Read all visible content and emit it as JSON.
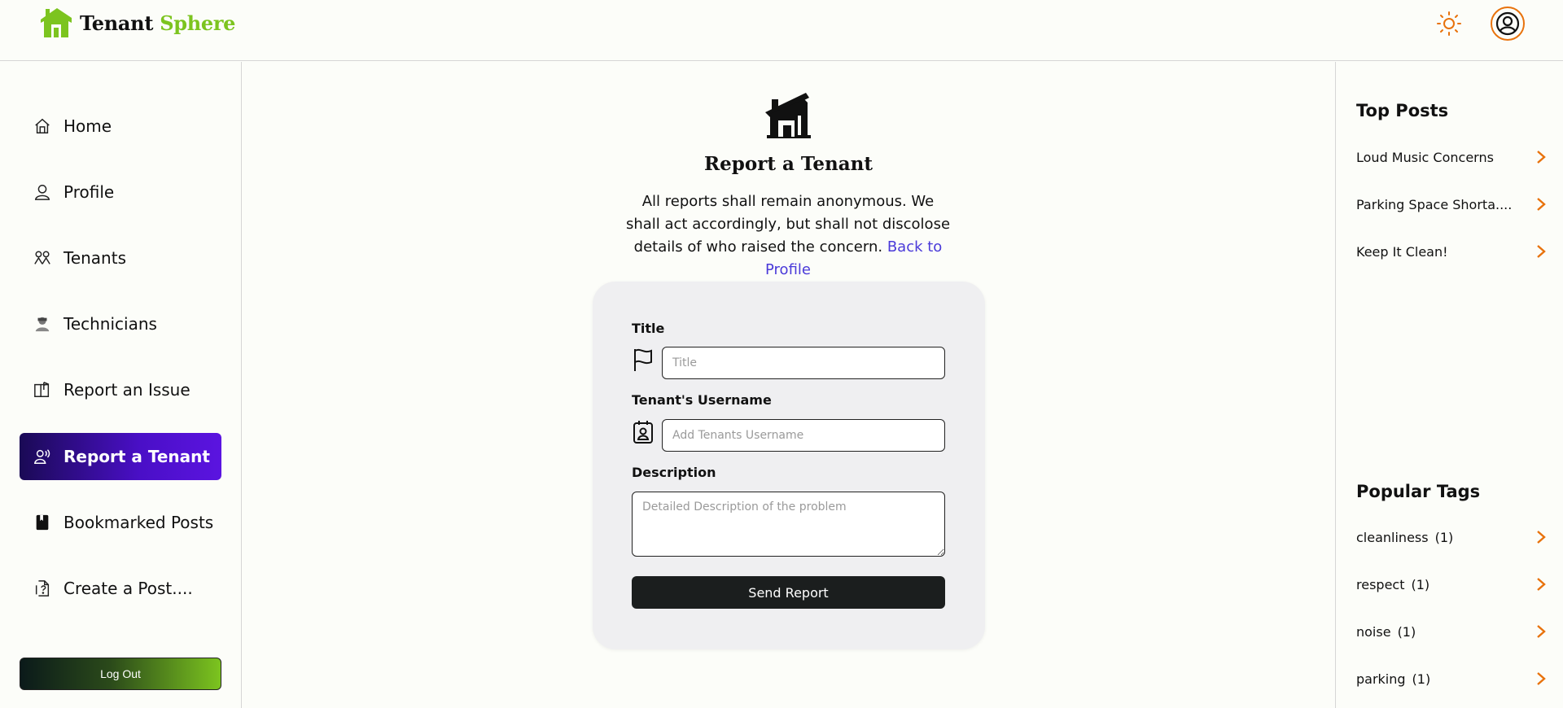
{
  "brand": {
    "name_part1": "Tenant",
    "name_part2": "Sphere",
    "accent_color": "#7cc41f"
  },
  "header": {
    "theme_icon": "sun-icon",
    "avatar_icon": "user-circle-icon"
  },
  "sidebar": {
    "items": [
      {
        "label": "Home",
        "icon": "home-icon"
      },
      {
        "label": "Profile",
        "icon": "user-icon"
      },
      {
        "label": "Tenants",
        "icon": "users-icon"
      },
      {
        "label": "Technicians",
        "icon": "technician-icon"
      },
      {
        "label": "Report an Issue",
        "icon": "book-report-icon"
      },
      {
        "label": "Report a Tenant",
        "icon": "user-voice-icon",
        "active": true
      },
      {
        "label": "Bookmarked Posts",
        "icon": "bookmark-book-icon"
      },
      {
        "label": "Create a Post....",
        "icon": "file-question-icon"
      }
    ],
    "logout_label": "Log Out",
    "active_gradient": [
      "#1a0a55",
      "#5b14e0"
    ]
  },
  "main": {
    "title": "Report a Tenant",
    "description": "All reports shall remain anonymous. We shall act accordingly, but shall not discolose details of who raised the concern.",
    "back_link": "Back to Profile",
    "form": {
      "title_label": "Title",
      "title_placeholder": "Title",
      "username_label": "Tenant's Username",
      "username_placeholder": "Add Tenants Username",
      "description_label": "Description",
      "description_placeholder": "Detailed Description of the problem",
      "submit_label": "Send Report"
    }
  },
  "rightbar": {
    "top_posts_heading": "Top Posts",
    "top_posts": [
      "Loud Music Concerns",
      "Parking Space Shorta....",
      "Keep It Clean!"
    ],
    "tags_heading": "Popular Tags",
    "tags": [
      {
        "name": "cleanliness",
        "count": "(1)"
      },
      {
        "name": "respect",
        "count": "(1)"
      },
      {
        "name": "noise",
        "count": "(1)"
      },
      {
        "name": "parking",
        "count": "(1)"
      }
    ],
    "chevron_color": "#e8720c"
  }
}
